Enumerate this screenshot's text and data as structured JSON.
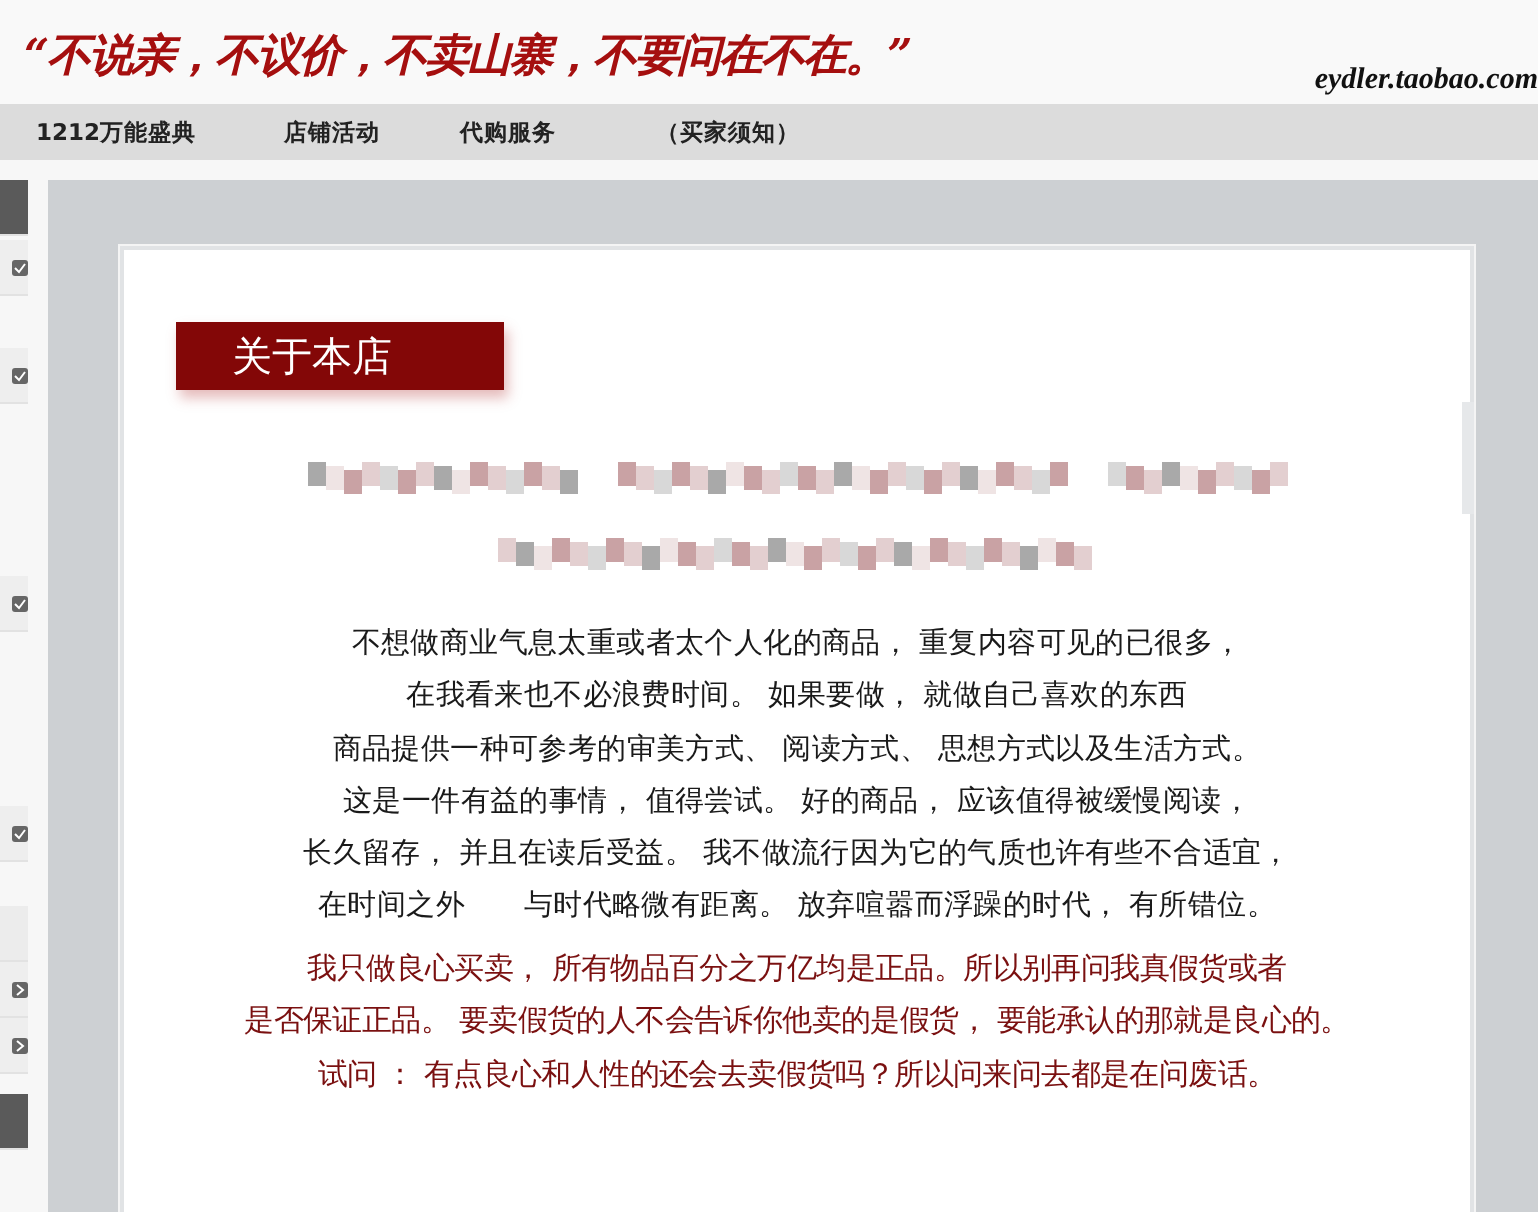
{
  "header": {
    "slogan": "“不说亲，不议价，不卖山寨，不要问在不在。”",
    "site": "eydler.taobao.com"
  },
  "nav": [
    {
      "label": "1212万能盛典"
    },
    {
      "label": "店铺活动"
    },
    {
      "label": "代购服务"
    },
    {
      "label": "（买家须知）"
    }
  ],
  "sidebar": [
    {
      "kind": "header"
    },
    {
      "kind": "check"
    },
    {
      "kind": "check"
    },
    {
      "kind": "check"
    },
    {
      "kind": "check"
    },
    {
      "kind": "plain"
    },
    {
      "kind": "arrow"
    },
    {
      "kind": "arrow"
    },
    {
      "kind": "header"
    }
  ],
  "card": {
    "title": "关于本店",
    "paragraphs": [
      {
        "color": "#1a1a1a",
        "lines": [
          "不想做商业气息太重或者太个人化的商品， 重复内容可见的已很多，",
          "在我看来也不必浪费时间。 如果要做， 就做自己喜欢的东西",
          "商品提供一种可参考的审美方式、 阅读方式、 思想方式以及生活方式。",
          "这是一件有益的事情， 值得尝试。 好的商品， 应该值得被缓慢阅读，",
          "长久留存， 并且在读后受益。 我不做流行因为它的气质也许有些不合适宜，",
          "在时间之外　　与时代略微有距离。 放弃喧嚣而浮躁的时代， 有所错位。"
        ]
      },
      {
        "color": "#7a1010",
        "lines": [
          "我只做良心买卖， 所有物品百分之万亿均是正品。所以别再问我真假货或者",
          "是否保证正品。 要卖假货的人不会告诉你他卖的是假货， 要能承认的那就是良心的。",
          "试问 ： 有点良心和人性的还会去卖假货吗？所以问来问去都是在问废话。"
        ]
      }
    ]
  }
}
